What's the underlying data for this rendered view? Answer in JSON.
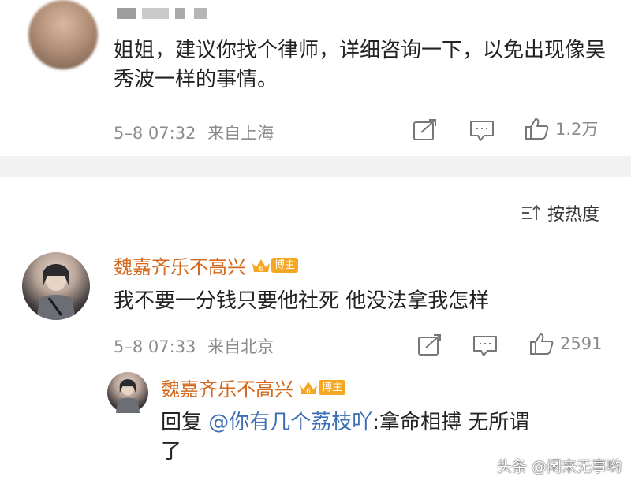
{
  "comment1": {
    "text": "姐姐，建议你找个律师，详细咨询一下，以免出现像吴秀波一样的事情。",
    "time": "5–8 07:32",
    "location": "来自上海",
    "likes": "1.2万"
  },
  "sort": {
    "label": "按热度"
  },
  "comment2": {
    "username": "魏嘉齐乐不高兴",
    "badge_level": "6",
    "badge_label": "博主",
    "text": "我不要一分钱只要他社死 他没法拿我怎样",
    "time": "5–8 07:33",
    "location": "来自北京",
    "likes": "2591"
  },
  "reply": {
    "username": "魏嘉齐乐不高兴",
    "badge_level": "6",
    "badge_label": "博主",
    "prefix": "回复",
    "mention": "@你有几个荔枝吖",
    "text_line1": ":拿命相搏 无所谓",
    "text_line2": "了"
  },
  "watermark": "头条 @闲来无事哟",
  "colors": {
    "username": "#d2691e",
    "mention": "#3d6fb6",
    "meta": "#8c8c8c",
    "badge": "#f5a623"
  }
}
